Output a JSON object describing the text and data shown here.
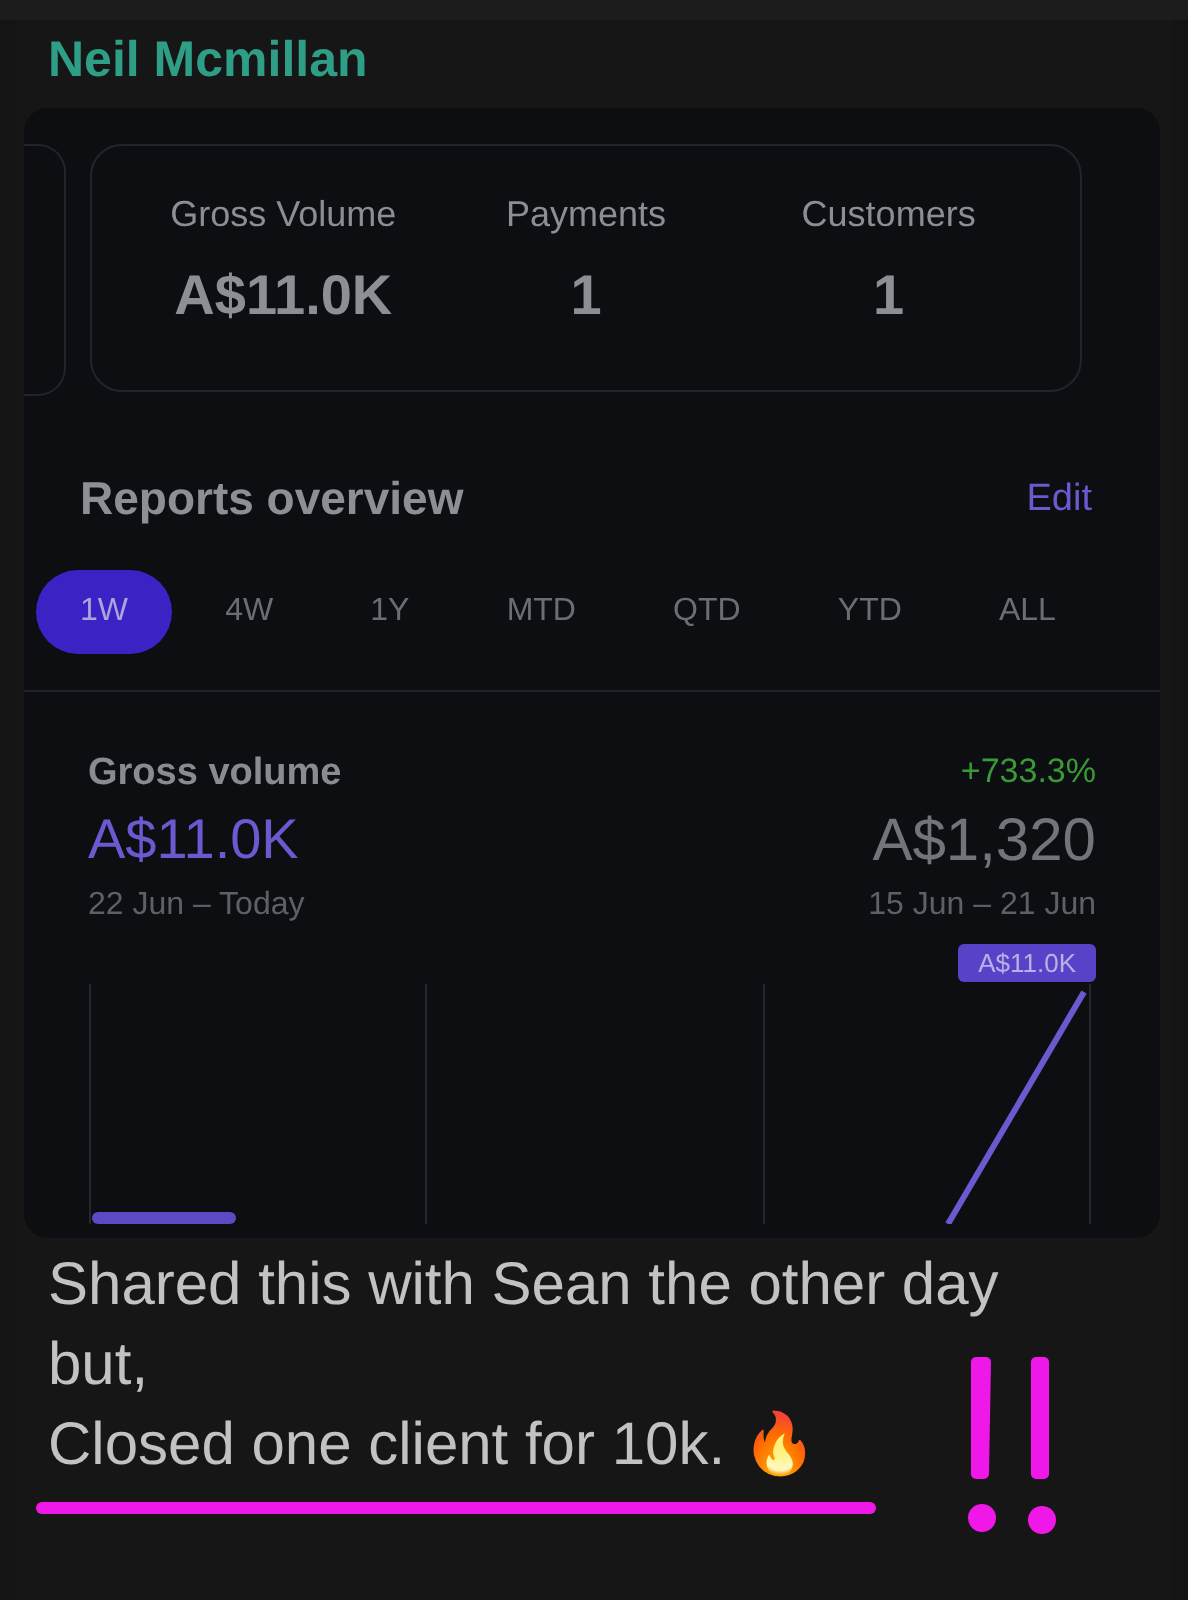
{
  "sender": "Neil Mcmillan",
  "today_stats": [
    {
      "label": "Gross Volume",
      "value": "A$11.0K"
    },
    {
      "label": "Payments",
      "value": "1"
    },
    {
      "label": "Customers",
      "value": "1"
    }
  ],
  "reports": {
    "title": "Reports overview",
    "edit": "Edit",
    "ranges": [
      {
        "label": "1W",
        "selected": true
      },
      {
        "label": "4W",
        "selected": false
      },
      {
        "label": "1Y",
        "selected": false
      },
      {
        "label": "MTD",
        "selected": false
      },
      {
        "label": "QTD",
        "selected": false
      },
      {
        "label": "YTD",
        "selected": false
      },
      {
        "label": "ALL",
        "selected": false
      }
    ],
    "gross": {
      "title": "Gross volume",
      "current": "A$11.0K",
      "current_period": "22 Jun – Today",
      "change": "+733.3%",
      "previous": "A$1,320",
      "previous_period": "15 Jun – 21 Jun",
      "chart_tag": "A$11.0K"
    }
  },
  "message_lines": [
    "Shared this with Sean the other day",
    "but,",
    "Closed one client for 10k. 🔥"
  ]
}
